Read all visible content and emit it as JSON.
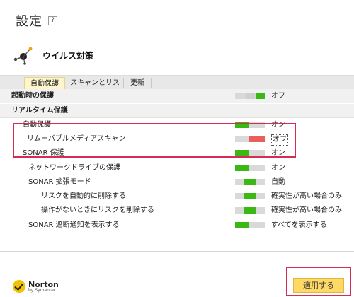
{
  "header": {
    "title": "設定",
    "help_label": "?"
  },
  "section": {
    "title": "ウイルス対策",
    "icon": "virus-icon"
  },
  "tabs": [
    {
      "label": "自動保護",
      "active": true
    },
    {
      "label": "スキャンとリスク",
      "active": false
    },
    {
      "label": "更新",
      "active": false
    }
  ],
  "rows": [
    {
      "label": "起動時の保護",
      "status": "オフ",
      "toggle": "off",
      "group": true
    },
    {
      "label": "リアルタイム保護",
      "group": true
    },
    {
      "label": "自動保護",
      "status": "オン",
      "toggle": "on"
    },
    {
      "label": "リムーバブルメディアスキャン",
      "status": "オフ",
      "toggle": "off-red"
    },
    {
      "label": "SONAR 保護",
      "status": "オン",
      "toggle": "on"
    },
    {
      "label": "ネットワークドライブの保護",
      "status": "オン",
      "toggle": "on"
    },
    {
      "label": "SONAR 拡張モード",
      "status": "自動",
      "toggle": "auto"
    },
    {
      "label": "リスクを自動的に削除する",
      "status": "確実性が高い場合のみ",
      "toggle": "auto"
    },
    {
      "label": "操作がないときにリスクを削除する",
      "status": "確実性が高い場合のみ",
      "toggle": "auto"
    },
    {
      "label": "SONAR 遮断通知を表示する",
      "status": "すべてを表示する",
      "toggle": "on"
    }
  ],
  "footer": {
    "logo_brand": "Norton",
    "logo_by": "by Symantec",
    "apply_label": "適用する"
  },
  "colors": {
    "accent_yellow": "#ffd966",
    "toggle_on": "#3cb815",
    "toggle_off_red": "#e8605d",
    "highlight": "#d62d55"
  }
}
